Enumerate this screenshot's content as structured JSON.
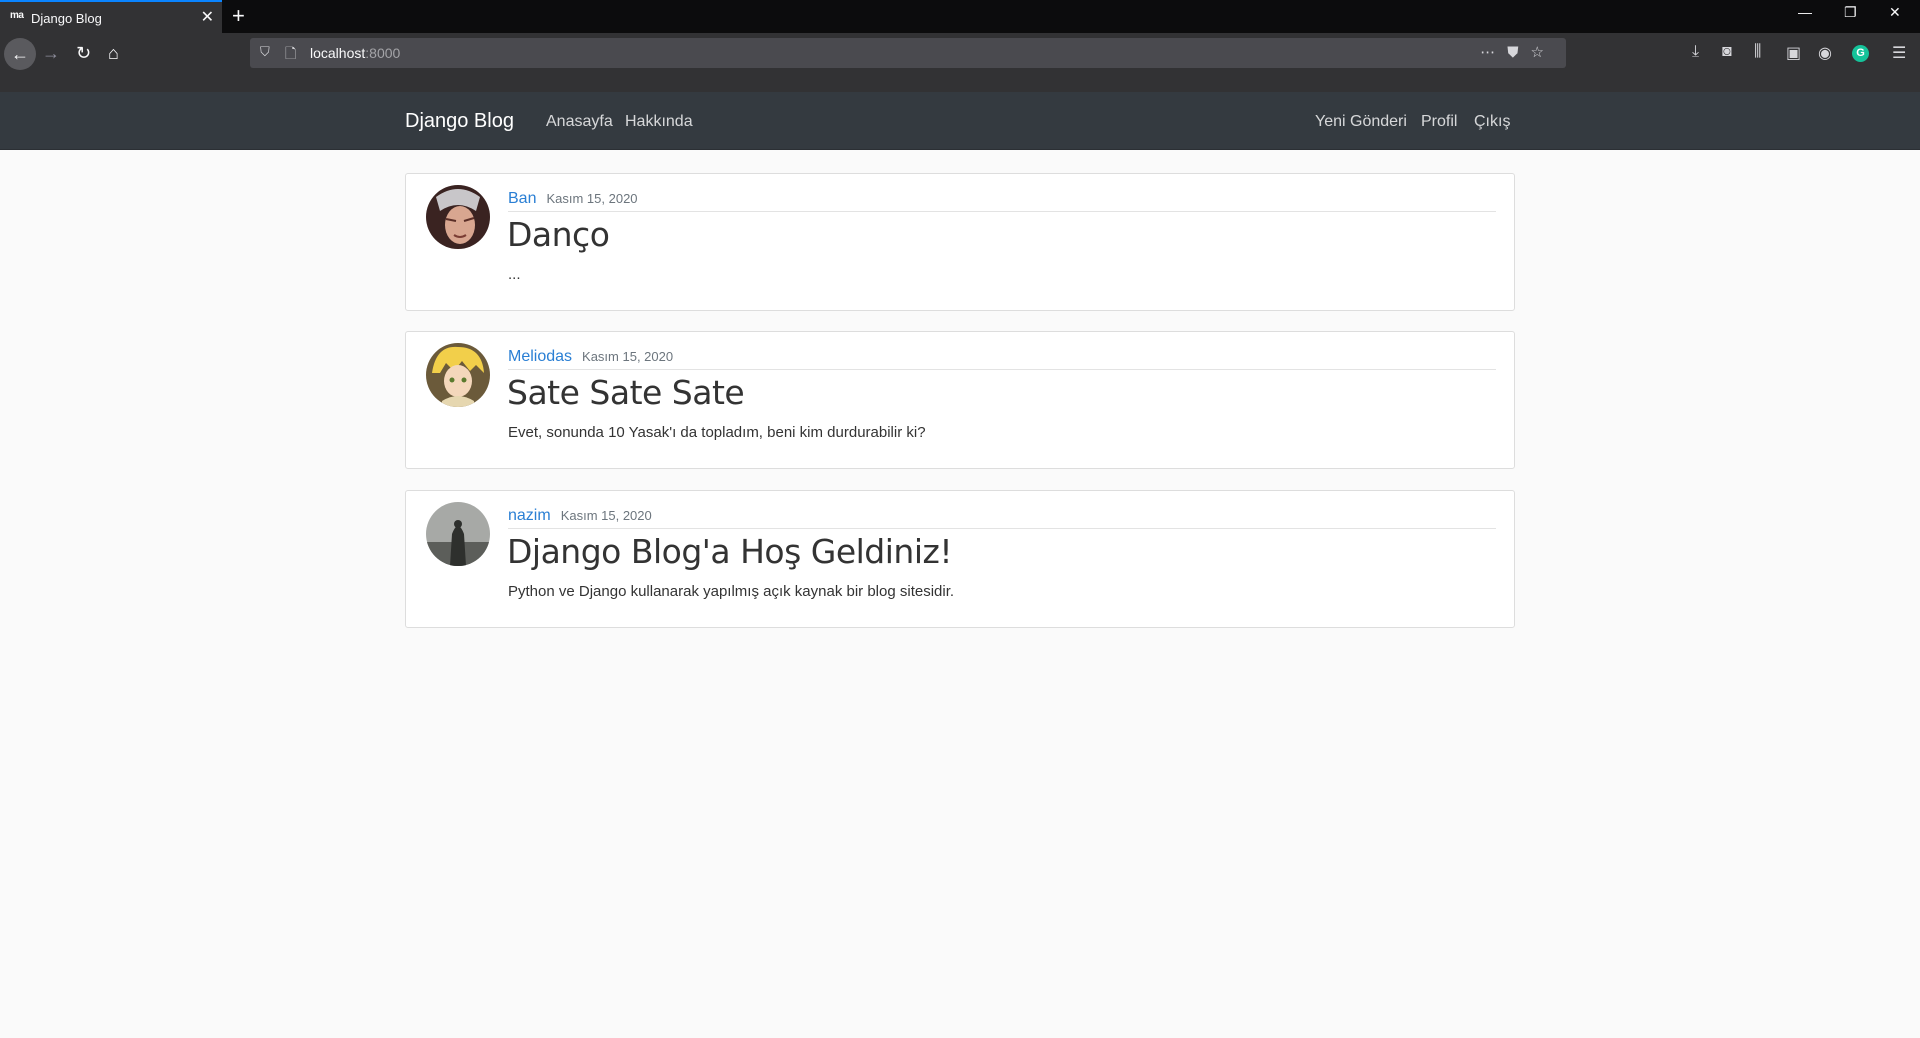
{
  "browser": {
    "tab_title": "Django Blog",
    "tab_favicon": "ma",
    "new_tab_label": "+",
    "url_host": "localhost",
    "url_port": ":8000"
  },
  "site": {
    "brand": "Django Blog",
    "nav_left": [
      "Anasayfa",
      "Hakkında"
    ],
    "nav_right": [
      "Yeni Gönderi",
      "Profil",
      "Çıkış"
    ]
  },
  "posts": [
    {
      "author": "Ban",
      "date": "Kasım 15, 2020",
      "title": "Danço",
      "content": "..."
    },
    {
      "author": "Meliodas",
      "date": "Kasım 15, 2020",
      "title": "Sate Sate Sate",
      "content": "Evet, sonunda 10 Yasak'ı da topladım, beni kim durdurabilir ki?"
    },
    {
      "author": "nazim",
      "date": "Kasım 15, 2020",
      "title": "Django Blog'a Hoş Geldiniz!",
      "content": "Python ve Django kullanarak yapılmış açık kaynak bir blog sitesidir."
    }
  ],
  "colors": {
    "navbar_bg": "#343a40",
    "link": "#2a7fd4",
    "page_bg": "#fafafa"
  },
  "icons": [
    "back-arrow-icon",
    "forward-arrow-icon",
    "reload-icon",
    "home-icon",
    "shield-icon",
    "page-icon",
    "more-actions-icon",
    "pocket-icon",
    "bookmark-star-icon",
    "download-icon",
    "mask-icon",
    "library-icon",
    "sidebar-icon",
    "account-icon",
    "grammarly-icon",
    "menu-icon"
  ]
}
